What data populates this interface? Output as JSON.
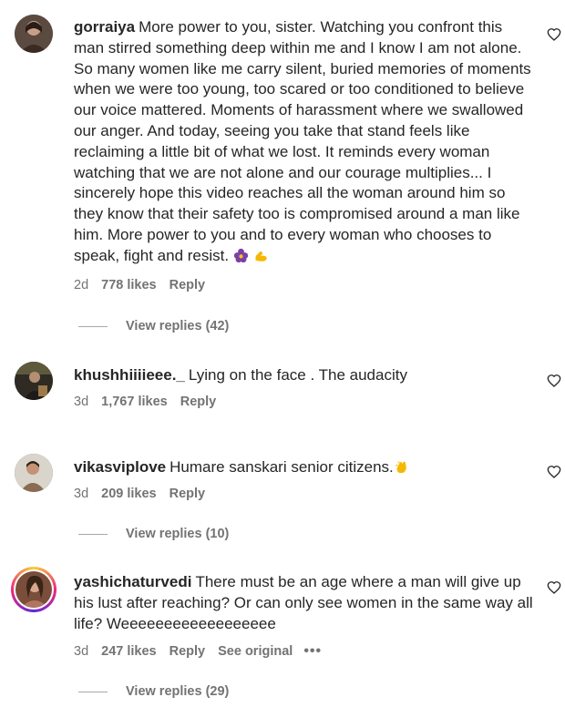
{
  "comments": [
    {
      "username": "gorraiya",
      "text": "More power to you, sister. Watching you confront this man stirred something deep within me and I know I am not alone. So many women like me carry silent, buried memories of moments when we were too young, too scared or too conditioned to believe our voice mattered. Moments of harassment where we swallowed our anger. And today, seeing you take that stand feels like reclaiming a little bit of what we lost. It reminds every woman watching that we are not alone and our courage multiplies... I sincerely hope this video reaches all the woman around him so they know that their safety too is compromised around a man like him. More power to you and to every woman who chooses to speak, fight and resist.",
      "emojis": [
        "purple-flower-icon",
        "flexed-biceps-icon"
      ],
      "age": "2d",
      "likes": "778 likes",
      "reply": "Reply",
      "view_replies": "View replies (42)"
    },
    {
      "username": "khushhiiiieee._",
      "text": "Lying on the face . The audacity",
      "age": "3d",
      "likes": "1,767 likes",
      "reply": "Reply"
    },
    {
      "username": "vikasviplove",
      "text": "Humare sanskari senior citizens.",
      "emojis": [
        "clapping-hands-icon"
      ],
      "age": "3d",
      "likes": "209 likes",
      "reply": "Reply",
      "view_replies": "View replies (10)"
    },
    {
      "username": "yashichaturvedi",
      "text": "There must be an age where a man will give up his lust after reaching? Or can only see women in the same way all life? Weeeeeeeeeeeeeeeeee",
      "age": "3d",
      "likes": "247 likes",
      "reply": "Reply",
      "see_original": "See original",
      "more": "•••",
      "view_replies": "View replies (29)"
    }
  ],
  "colors": {
    "text": "#262626",
    "secondary": "#737373",
    "divider": "#a8a8a8"
  }
}
